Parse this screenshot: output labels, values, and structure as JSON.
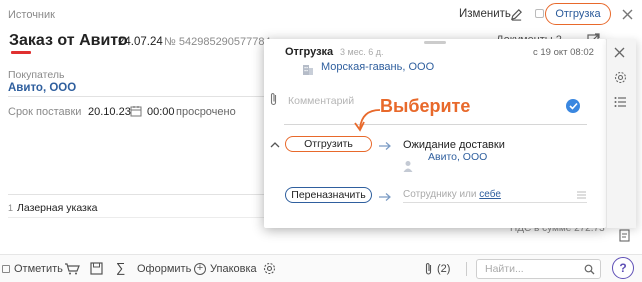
{
  "header": {
    "source_label": "Источник",
    "edit_label": "Изменить",
    "status_label": "Отгрузка"
  },
  "document": {
    "title": "Заказ от Авито",
    "date": "24.07.24",
    "number": "№ 542985290577784",
    "docs_link": "Документы 2",
    "buyer_label": "Покупатель",
    "buyer_value": "Авито, ООО",
    "delivery_label": "Срок поставки",
    "delivery_date": "20.10.23",
    "delivery_time": "00:00",
    "delivery_status": "просрочено",
    "item_number": "1",
    "item_name": "Лазерная указка",
    "vat_row": "НДС в сумме   272.73"
  },
  "popup": {
    "title": "Отгрузка",
    "ago": "3 мес. 6 д.",
    "timestamp": "с 19 окт 08:02",
    "org": "Морская-гавань, ООО",
    "comment_placeholder": "Комментарий",
    "annotation": "Выберите",
    "ship_button": "Отгрузить",
    "reassign_button": "Переназначить",
    "wait_title": "Ожидание доставки",
    "wait_org": "Авито, ООО",
    "assignee_text": "Сотруднику или",
    "assignee_self": "себе"
  },
  "toolbar": {
    "mark_label": "Отметить",
    "sigma": "∑",
    "process_label": "Оформить",
    "pack_label": "Упаковка",
    "attach_count": "(2)",
    "search_placeholder": "Найти...",
    "help": "?"
  },
  "colors": {
    "accent_orange": "#e8692b",
    "link_blue": "#2f5f9e",
    "check_blue": "#3a87e0",
    "help_purple": "#5e4fb6",
    "title_red": "#e03030"
  }
}
